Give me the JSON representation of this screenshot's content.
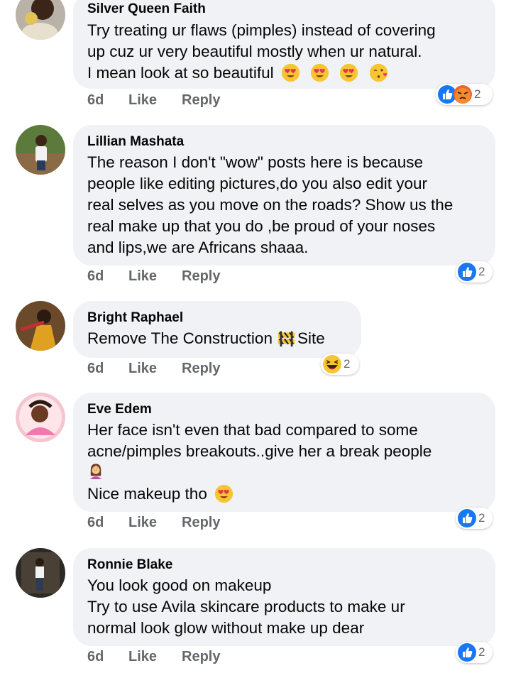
{
  "colors": {
    "bubble": "#f0f2f5",
    "author": "#050505",
    "action": "#65676b",
    "like_blue": "#1877f2",
    "angry_orange": "#f0622a",
    "emoji_yellow": "#f7c531"
  },
  "comments": [
    {
      "author": "Silver Queen Faith",
      "lines": [
        "Try treating ur flaws (pimples) instead of covering",
        "up cuz ur very beautiful mostly when ur natural.",
        "I mean look at so beautiful"
      ],
      "emoji": [
        "heart-eyes-emoji",
        "heart-eyes-emoji",
        "heart-eyes-emoji",
        "kissing-heart-emoji"
      ],
      "time": "6d",
      "like": "Like",
      "reply": "Reply",
      "reactions": [
        "like-reaction-icon",
        "angry-reaction-icon"
      ],
      "reaction_count": "2"
    },
    {
      "author": "Lillian Mashata",
      "lines": [
        "The reason I don't \"wow\" posts here is because",
        "people like editing pictures,do you also edit your",
        "real selves as you move on the roads? Show us the",
        "real make up that you do ,be proud of your noses",
        "and lips,we are Africans shaaa."
      ],
      "time": "6d",
      "like": "Like",
      "reply": "Reply",
      "reactions": [
        "like-reaction-icon"
      ],
      "reaction_count": "2"
    },
    {
      "author": "Bright Raphael",
      "lines": [
        "Remove The Construction",
        "Site"
      ],
      "emoji": [
        "construction-emoji"
      ],
      "time": "6d",
      "like": "Like",
      "reply": "Reply",
      "reactions": [
        "haha-reaction-icon"
      ],
      "reaction_count": "2"
    },
    {
      "author": "Eve Edem",
      "lines": [
        "Her face isn't even that bad compared to some",
        "acne/pimples breakouts..give her a break people",
        "Nice makeup tho"
      ],
      "emoji": [
        "facepalm-woman-emoji",
        "heart-eyes-emoji"
      ],
      "time": "6d",
      "like": "Like",
      "reply": "Reply",
      "reactions": [
        "like-reaction-icon"
      ],
      "reaction_count": "2"
    },
    {
      "author": "Ronnie Blake",
      "lines": [
        "You look good on makeup",
        "Try to use Avila skincare products to make ur",
        "normal look glow without make up dear"
      ],
      "time": "6d",
      "like": "Like",
      "reply": "Reply",
      "reactions": [
        "like-reaction-icon"
      ],
      "reaction_count": "2"
    }
  ]
}
